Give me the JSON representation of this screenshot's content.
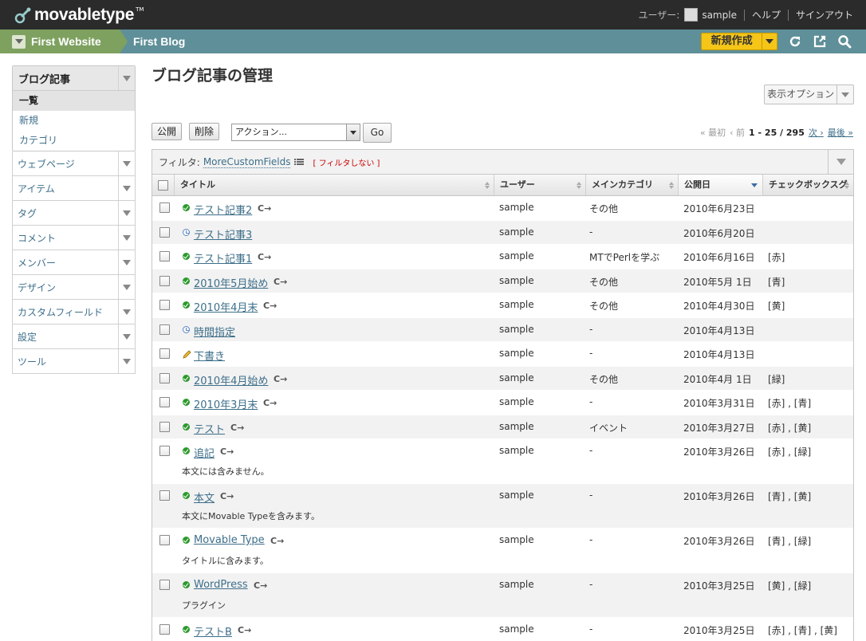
{
  "app": {
    "logo_text": "movabletype",
    "logo_tm": "TM"
  },
  "topnav": {
    "user_label": "ユーザー:",
    "user_name": "sample",
    "help": "ヘルプ",
    "signout": "サインアウト"
  },
  "scope": {
    "website": "First Website",
    "blog": "First Blog",
    "new_button": "新規作成",
    "icons": [
      "refresh-icon",
      "external-link-icon",
      "search-icon"
    ]
  },
  "sidebar": {
    "active_group": {
      "label": "ブログ記事",
      "subitems": [
        "一覧",
        "新規",
        "カテゴリ"
      ]
    },
    "items": [
      "ウェブページ",
      "アイテム",
      "タグ",
      "コメント",
      "メンバー",
      "デザイン",
      "カスタムフィールド",
      "設定",
      "ツール"
    ]
  },
  "main": {
    "title": "ブログ記事の管理",
    "display_options": "表示オプション",
    "publish_button": "公開",
    "delete_button": "削除",
    "action_select": "アクション...",
    "go_button": "Go",
    "pager": {
      "first": "« 最初",
      "prev": "‹ 前",
      "range": "1 - 25 / 295",
      "next": "次 ›",
      "last": "最後 »"
    },
    "filter": {
      "label": "フィルタ:",
      "name": "MoreCustomFields",
      "none": "[ フィルタしない ]"
    },
    "columns": [
      "タイトル",
      "ユーザー",
      "メインカテゴリ",
      "公開日",
      "チェックボックスグ"
    ],
    "rows": [
      {
        "status": "published",
        "title": "テスト記事2",
        "excerpt": "",
        "user": "sample",
        "category": "その他",
        "date": "2010年6月23日",
        "check": ""
      },
      {
        "status": "scheduled",
        "title": "テスト記事3",
        "excerpt": "",
        "user": "sample",
        "category": "-",
        "date": "2010年6月20日",
        "check": ""
      },
      {
        "status": "published",
        "title": "テスト記事1",
        "excerpt": "",
        "user": "sample",
        "category": "MTでPerlを学ぶ",
        "date": "2010年6月16日",
        "check": "[赤]"
      },
      {
        "status": "published",
        "title": "2010年5月始め",
        "excerpt": "",
        "user": "sample",
        "category": "その他",
        "date": "2010年5月 1日",
        "check": "[青]"
      },
      {
        "status": "published",
        "title": "2010年4月末",
        "excerpt": "",
        "user": "sample",
        "category": "その他",
        "date": "2010年4月30日",
        "check": "[黄]"
      },
      {
        "status": "scheduled",
        "title": "時間指定",
        "excerpt": "",
        "user": "sample",
        "category": "-",
        "date": "2010年4月13日",
        "check": ""
      },
      {
        "status": "draft",
        "title": "下書き",
        "excerpt": "",
        "user": "sample",
        "category": "-",
        "date": "2010年4月13日",
        "check": ""
      },
      {
        "status": "published",
        "title": "2010年4月始め",
        "excerpt": "",
        "user": "sample",
        "category": "その他",
        "date": "2010年4月 1日",
        "check": "[緑]"
      },
      {
        "status": "published",
        "title": "2010年3月末",
        "excerpt": "",
        "user": "sample",
        "category": "-",
        "date": "2010年3月31日",
        "check": "[赤] , [青]"
      },
      {
        "status": "published",
        "title": "テスト",
        "excerpt": "",
        "user": "sample",
        "category": "イベント",
        "date": "2010年3月27日",
        "check": "[赤] , [黄]"
      },
      {
        "status": "published",
        "title": "追記",
        "excerpt": "本文には含みません。",
        "user": "sample",
        "category": "-",
        "date": "2010年3月26日",
        "check": "[赤] , [緑]"
      },
      {
        "status": "published",
        "title": "本文",
        "excerpt": "本文にMovable Typeを含みます。",
        "user": "sample",
        "category": "-",
        "date": "2010年3月26日",
        "check": "[青] , [黄]"
      },
      {
        "status": "published",
        "title": "Movable Type",
        "excerpt": "タイトルに含みます。",
        "user": "sample",
        "category": "-",
        "date": "2010年3月26日",
        "check": "[青] , [緑]"
      },
      {
        "status": "published",
        "title": "WordPress",
        "excerpt": "プラグイン",
        "user": "sample",
        "category": "-",
        "date": "2010年3月25日",
        "check": "[黄] , [緑]"
      },
      {
        "status": "published",
        "title": "テストB",
        "excerpt": "",
        "user": "sample",
        "category": "-",
        "date": "2010年3月25日",
        "check": "[赤] , [青] , [黄]"
      }
    ]
  }
}
